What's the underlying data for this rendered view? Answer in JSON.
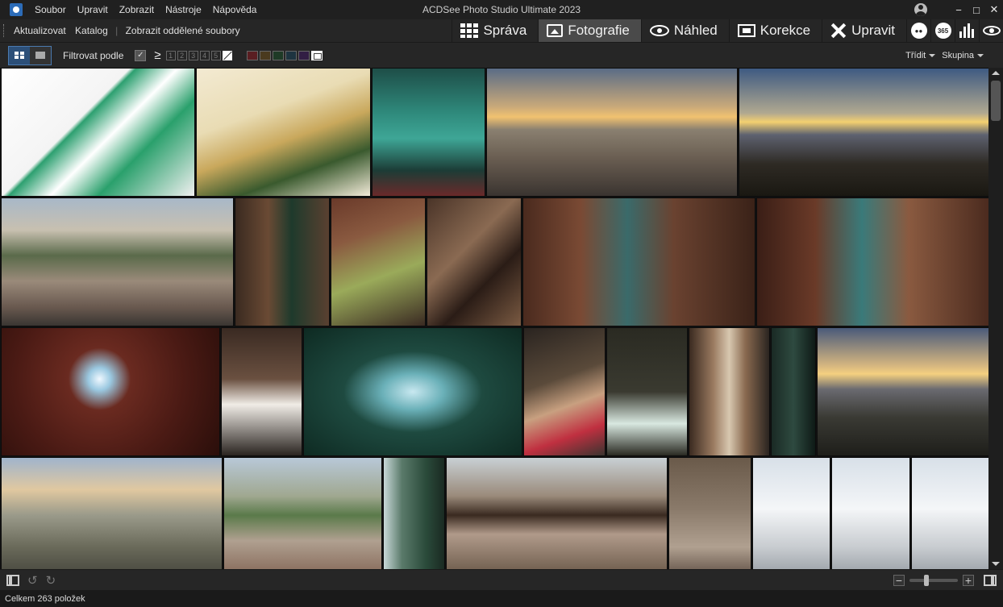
{
  "window": {
    "title": "ACDSee Photo Studio Ultimate 2023"
  },
  "menu": [
    "Soubor",
    "Upravit",
    "Zobrazit",
    "Nástroje",
    "Nápověda"
  ],
  "actions": {
    "refresh": "Aktualizovat",
    "catalog": "Katalog",
    "show_separate": "Zobrazit oddělené soubory"
  },
  "modes": [
    {
      "label": "Správa",
      "icon": "grid-icon",
      "active": false
    },
    {
      "label": "Fotografie",
      "icon": "photo-icon",
      "active": true
    },
    {
      "label": "Náhled",
      "icon": "eye-icon",
      "active": false
    },
    {
      "label": "Korekce",
      "icon": "develop-icon",
      "active": false
    },
    {
      "label": "Upravit",
      "icon": "edit-icon",
      "active": false
    }
  ],
  "mode_extras": {
    "vr_label": "365"
  },
  "filterbar": {
    "filter_label": "Filtrovat podle",
    "gte": "≥",
    "ratings": [
      "1",
      "2",
      "3",
      "4",
      "5"
    ],
    "sort_label": "Třídit",
    "group_label": "Skupina",
    "color_labels": [
      "#5a1e22",
      "#4a3a1e",
      "#1e3a26",
      "#1e3440",
      "#321e44"
    ]
  },
  "thumbnails": [
    {
      "r": 0,
      "w": 241,
      "bg": "linear-gradient(135deg,#ffffff 0%,#f4f4f4 40%,#2da070 42%,#ffffff 55%,#2aa06c 70%,#f0f0f0 100%)"
    },
    {
      "r": 0,
      "w": 217,
      "bg": "linear-gradient(160deg,#f3ead2 0%,#e9dcb4 35%,#c9a85c 55%,#3a5a2e 75%,#f2ead8 100%)"
    },
    {
      "r": 0,
      "w": 141,
      "bg": "linear-gradient(180deg,#1e4e48 0%,#2f8a7c 35%,#3ea696 55%,#1c3c36 80%,#6a2a2a 100%)"
    },
    {
      "r": 0,
      "w": 312,
      "bg": "linear-gradient(180deg,#5a6c86 0%,#c9a97a 30%,#f1c270 38%,#8a8070 48%,#6a5e52 70%,#3a3430 100%)"
    },
    {
      "r": 0,
      "w": 313,
      "bg": "linear-gradient(180deg,#3e5a82 0%,#b0a890 35%,#f4d070 42%,#5e6270 52%,#2e2a24 75%,#1a1812 100%)"
    },
    {
      "r": 1,
      "w": 289,
      "bg": "linear-gradient(180deg,#a8b8c8 0%,#c8c0b0 25%,#5a6a4a 45%,#9a8a7a 65%,#6a5a50 85%,#3a3632 100%)"
    },
    {
      "r": 1,
      "w": 118,
      "bg": "linear-gradient(90deg,#3a2a20 0%,#6a4a34 35%,#1e3a2c 60%,#5a4030 100%)"
    },
    {
      "r": 1,
      "w": 118,
      "bg": "linear-gradient(160deg,#6a3a2a 0%,#8a5a40 30%,#9aaa5a 60%,#3a2a22 100%)"
    },
    {
      "r": 1,
      "w": 118,
      "bg": "linear-gradient(135deg,#4a3428 0%,#8a6a52 40%,#2a1c16 65%,#7a5a42 100%)"
    },
    {
      "r": 1,
      "w": 289,
      "bg": "linear-gradient(90deg,#4a2a1e 0%,#7a4a34 25%,#3a6a6a 45%,#6a4230 65%,#3a2218 100%)"
    },
    {
      "r": 1,
      "w": 291,
      "bg": "linear-gradient(90deg,#3a1e16 0%,#6a3a28 25%,#3a7a7a 45%,#8a5a40 65%,#4a2a1e 100%)"
    },
    {
      "r": 2,
      "w": 272,
      "bg": "radial-gradient(circle at 45% 40%,#f0f8ff 0%,#9ac8e0 8%,#6a2a20 22%,#4a1a14 60%,#2a0e0a 100%)"
    },
    {
      "r": 2,
      "w": 101,
      "bg": "linear-gradient(180deg,#3a2a22 0%,#6a5040 40%,#f0ece6 60%,#2a2420 100%)"
    },
    {
      "r": 2,
      "w": 272,
      "bg": "radial-gradient(ellipse at 50% 50%,#c8e8f0 0%,#6ab0b8 20%,#1e4a40 45%,#0e2a22 100%)"
    },
    {
      "r": 2,
      "w": 102,
      "bg": "linear-gradient(160deg,#2a2420 0%,#5a4a3a 40%,#c8a080 60%,#c03040 80%,#3a3430 100%)"
    },
    {
      "r": 2,
      "w": 101,
      "bg": "linear-gradient(180deg,#2a2a22 0%,#3a3a30 50%,#d8e8e0 75%,#2a2a22 100%)"
    },
    {
      "r": 2,
      "w": 101,
      "bg": "linear-gradient(90deg,#3a2a20 0%,#9a7a60 30%,#d8c8b0 50%,#8a6a50 70%,#2a2420 100%)"
    },
    {
      "r": 2,
      "w": 56,
      "bg": "linear-gradient(90deg,#1a2a24 0%,#2e4a40 50%,#0e1a16 100%)"
    },
    {
      "r": 2,
      "w": 219,
      "bg": "linear-gradient(180deg,#4a5a7a 0%,#d8b880 30%,#f4d080 36%,#6a6a70 48%,#3a3a34 70%,#1e1e1a 100%)"
    },
    {
      "r": 3,
      "w": 275,
      "bg": "linear-gradient(180deg,#a0b4cc 0%,#e0c8a0 25%,#9a9a8a 45%,#6a6a5a 70%,#3a3a34 100%)"
    },
    {
      "r": 3,
      "w": 197,
      "bg": "linear-gradient(180deg,#b8c8d8 0%,#a0a890 30%,#5a7a4a 45%,#b0a090 65%,#7a5a4a 100%)"
    },
    {
      "r": 3,
      "w": 77,
      "bg": "linear-gradient(90deg,#c8d8d8 0%,#5a7a6a 30%,#2a4a3a 70%,#1a2a22 100%)"
    },
    {
      "r": 3,
      "w": 275,
      "bg": "linear-gradient(180deg,#c8d0d4 0%,#9a8a7a 30%,#3a2a20 45%,#b09a8a 60%,#5a4a3a 100%)"
    },
    {
      "r": 3,
      "w": 103,
      "bg": "linear-gradient(180deg,#6a5a4a 0%,#8a7a6a 40%,#b0a090 70%,#4a3a30 100%)"
    },
    {
      "r": 3,
      "w": 97,
      "bg": "linear-gradient(180deg,#d8e0e8 0%,#f4f6f8 40%,#c8ccd0 70%,#8a9098 100%)"
    },
    {
      "r": 3,
      "w": 98,
      "bg": "linear-gradient(180deg,#d8e0e8 0%,#f4f6f8 40%,#c8ccd0 70%,#8a9098 100%)"
    },
    {
      "r": 3,
      "w": 99,
      "bg": "linear-gradient(180deg,#d8e0e8 0%,#f4f6f8 40%,#c8ccd0 70%,#8a9098 100%)"
    }
  ],
  "status": {
    "total": "Celkem 263 položek"
  }
}
